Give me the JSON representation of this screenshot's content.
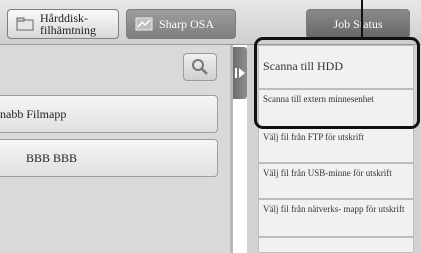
{
  "tabs": {
    "hdd_retrieval": "Hårddisk-\nfilhämtning",
    "sharp_osa": "Sharp OSA",
    "job_status": "Job Status"
  },
  "file_list": {
    "search_icon": "magnifier-icon",
    "items": [
      "nabb Filmapp",
      "BBB BBB"
    ]
  },
  "options": {
    "expand_icon": "play-arrow-icon",
    "items": [
      "Scanna till HDD",
      "Scanna till extern minnesenhet",
      "Välj fil från FTP för utskrift",
      "Välj fil från USB-minne för utskrift",
      "Välj fil från nätverks- mapp för utskrift"
    ]
  }
}
